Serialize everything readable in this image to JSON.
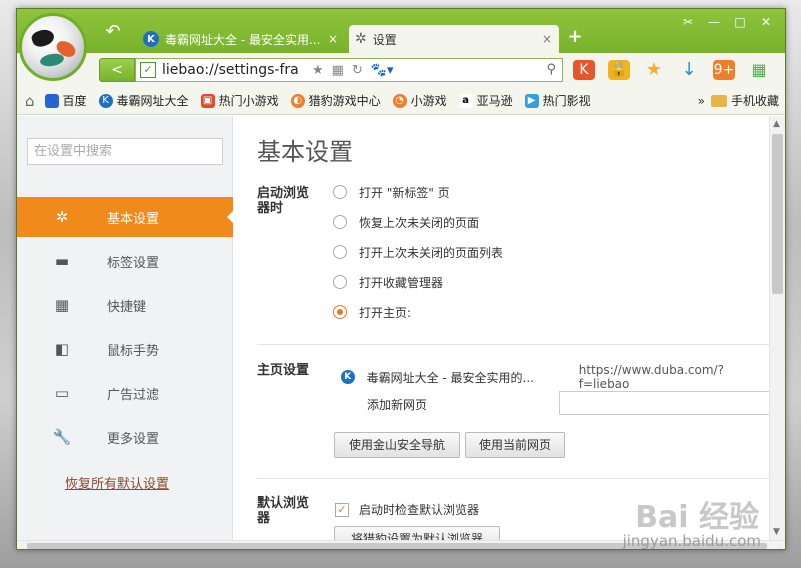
{
  "browser": {
    "tabs": [
      {
        "title": "毒霸网址大全 - 最安全实用...",
        "icon": "k-icon",
        "close": "×"
      },
      {
        "title": "设置",
        "icon": "gear-icon",
        "close": "×"
      }
    ],
    "new_tab": "+",
    "back": "↶",
    "window_controls": [
      "✂",
      "—",
      "□",
      "✕"
    ],
    "nav_arrow": "<",
    "url": "liebao://settings-fra",
    "secure_icon": "✓",
    "address_icons": [
      "★",
      "▦",
      "↻"
    ],
    "search_dropdown_icon": "🐾▾",
    "search_glass": "⚲",
    "toolbar_icons": [
      "K",
      "🔒",
      "★",
      "↓",
      "9+",
      "▦"
    ],
    "bookmarks": [
      {
        "label": "百度",
        "color": "#2b63d6",
        "glyph": "🐾"
      },
      {
        "label": "毒霸网址大全",
        "color": "#1e6fc9",
        "glyph": "K"
      },
      {
        "label": "热门小游戏",
        "color": "#e24b2a",
        "glyph": "▣"
      },
      {
        "label": "猎豹游戏中心",
        "color": "#f07d27",
        "glyph": "◐"
      },
      {
        "label": "小游戏",
        "color": "#f07d27",
        "glyph": "◔"
      },
      {
        "label": "亚马逊",
        "color": "#ffffff",
        "glyph": "a"
      },
      {
        "label": "热门影视",
        "color": "#33a0e0",
        "glyph": "▶"
      }
    ],
    "bookmarks_more": "»",
    "bookmarks_folder": "手机收藏",
    "home_icon": "⌂"
  },
  "sidebar": {
    "search_placeholder": "在设置中搜索",
    "items": [
      {
        "label": "基本设置",
        "icon": "✲",
        "active": true
      },
      {
        "label": "标签设置",
        "icon": "▬",
        "active": false
      },
      {
        "label": "快捷键",
        "icon": "▦",
        "active": false
      },
      {
        "label": "鼠标手势",
        "icon": "◧",
        "active": false
      },
      {
        "label": "广告过滤",
        "icon": "▭",
        "active": false
      },
      {
        "label": "更多设置",
        "icon": "🔧",
        "active": false
      }
    ],
    "reset": "恢复所有默认设置"
  },
  "main": {
    "title": "基本设置",
    "startup": {
      "label": "启动浏览器时",
      "options": [
        {
          "label": "打开 \"新标签\" 页",
          "checked": false
        },
        {
          "label": "恢复上次未关闭的页面",
          "checked": false
        },
        {
          "label": "打开上次未关闭的页面列表",
          "checked": false
        },
        {
          "label": "打开收藏管理器",
          "checked": false
        },
        {
          "label": "打开主页:",
          "checked": true
        }
      ]
    },
    "homepage": {
      "label": "主页设置",
      "site_title": "毒霸网址大全 - 最安全实用的...",
      "site_url": "https://www.duba.com/?f=liebao",
      "add_label": "添加新网页",
      "btn_jinshan": "使用金山安全导航",
      "btn_current": "使用当前网页"
    },
    "default_browser": {
      "label": "默认浏览器",
      "checkbox_label": "启动时检查默认浏览器",
      "checked": true,
      "btn_set_default": "将猎豹设置为默认浏览器"
    }
  },
  "watermark": {
    "main": "Bai 经验",
    "sub": "jingyan.baidu.com"
  }
}
